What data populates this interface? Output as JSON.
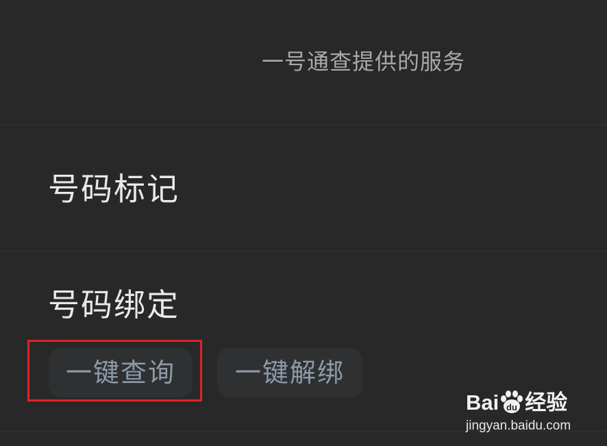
{
  "header": {
    "title": "一号通查提供的服务"
  },
  "rows": {
    "mark": {
      "label": "号码标记"
    },
    "bind": {
      "label": "号码绑定",
      "actions": {
        "query_label": "一键查询",
        "unbind_label": "一键解绑"
      }
    }
  },
  "watermark": {
    "logo": "Bai经验",
    "logo_left": "Bai",
    "logo_paw_text": "du",
    "logo_right": "经验",
    "url": "jingyan.baidu.com"
  },
  "colors": {
    "background": "#282828",
    "divider": "#333333",
    "primary_text": "#e9e9e9",
    "secondary_text": "#a9a9a9",
    "pill_background": "#2f3032",
    "pill_text": "#8e9aa8",
    "highlight": "#e0232a"
  },
  "icons": {
    "watermark_logo": "baidu-paw-icon"
  }
}
